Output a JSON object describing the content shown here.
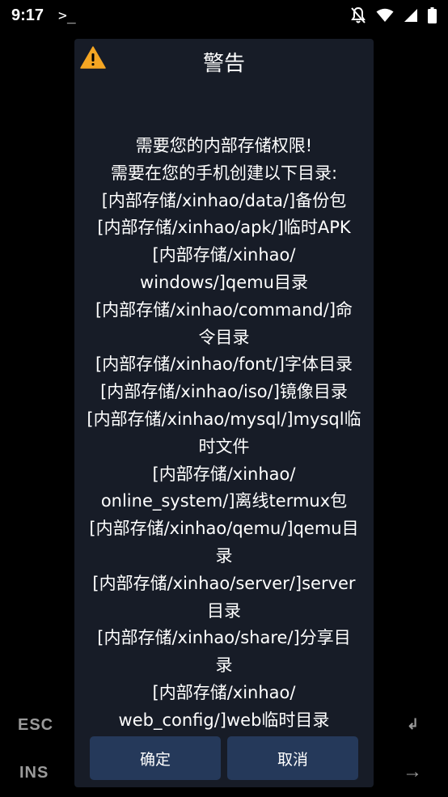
{
  "status_bar": {
    "time": "9:17",
    "app_icon": "terminal-prompt-icon",
    "icons": [
      "notifications-off-icon",
      "wifi-icon",
      "cell-signal-icon",
      "battery-icon"
    ]
  },
  "dialog": {
    "icon": "warning-icon",
    "title": "警告",
    "message_lines": [
      "需要您的内部存储权限!",
      "需要在您的手机创建以下目录:",
      "[内部存储/xinhao/data/]备份包",
      "[内部存储/xinhao/apk/]临时APK",
      "[内部存储/xinhao/",
      "windows/]qemu目录",
      "[内部存储/xinhao/command/]命",
      "令目录",
      "[内部存储/xinhao/font/]字体目录",
      "[内部存储/xinhao/iso/]镜像目录",
      "[内部存储/xinhao/mysql/]mysql临",
      "时文件",
      "[内部存储/xinhao/",
      "online_system/]离线termux包",
      "[内部存储/xinhao/qemu/]qemu目",
      "录",
      "[内部存储/xinhao/server/]server",
      "目录",
      "[内部存储/xinhao/share/]分享目",
      "录",
      "[内部存储/xinhao/",
      "web_config/]web临时目录"
    ],
    "confirm_label": "确定",
    "cancel_label": "取消"
  },
  "extra_keys": {
    "esc": "ESC",
    "ins": "INS",
    "enter": "↲",
    "arrow": "→"
  },
  "colors": {
    "background": "#000000",
    "dialog_background": "#171c27",
    "button_background": "#25395a",
    "warning": "#f5a623",
    "key_text": "#9a9a9a"
  }
}
